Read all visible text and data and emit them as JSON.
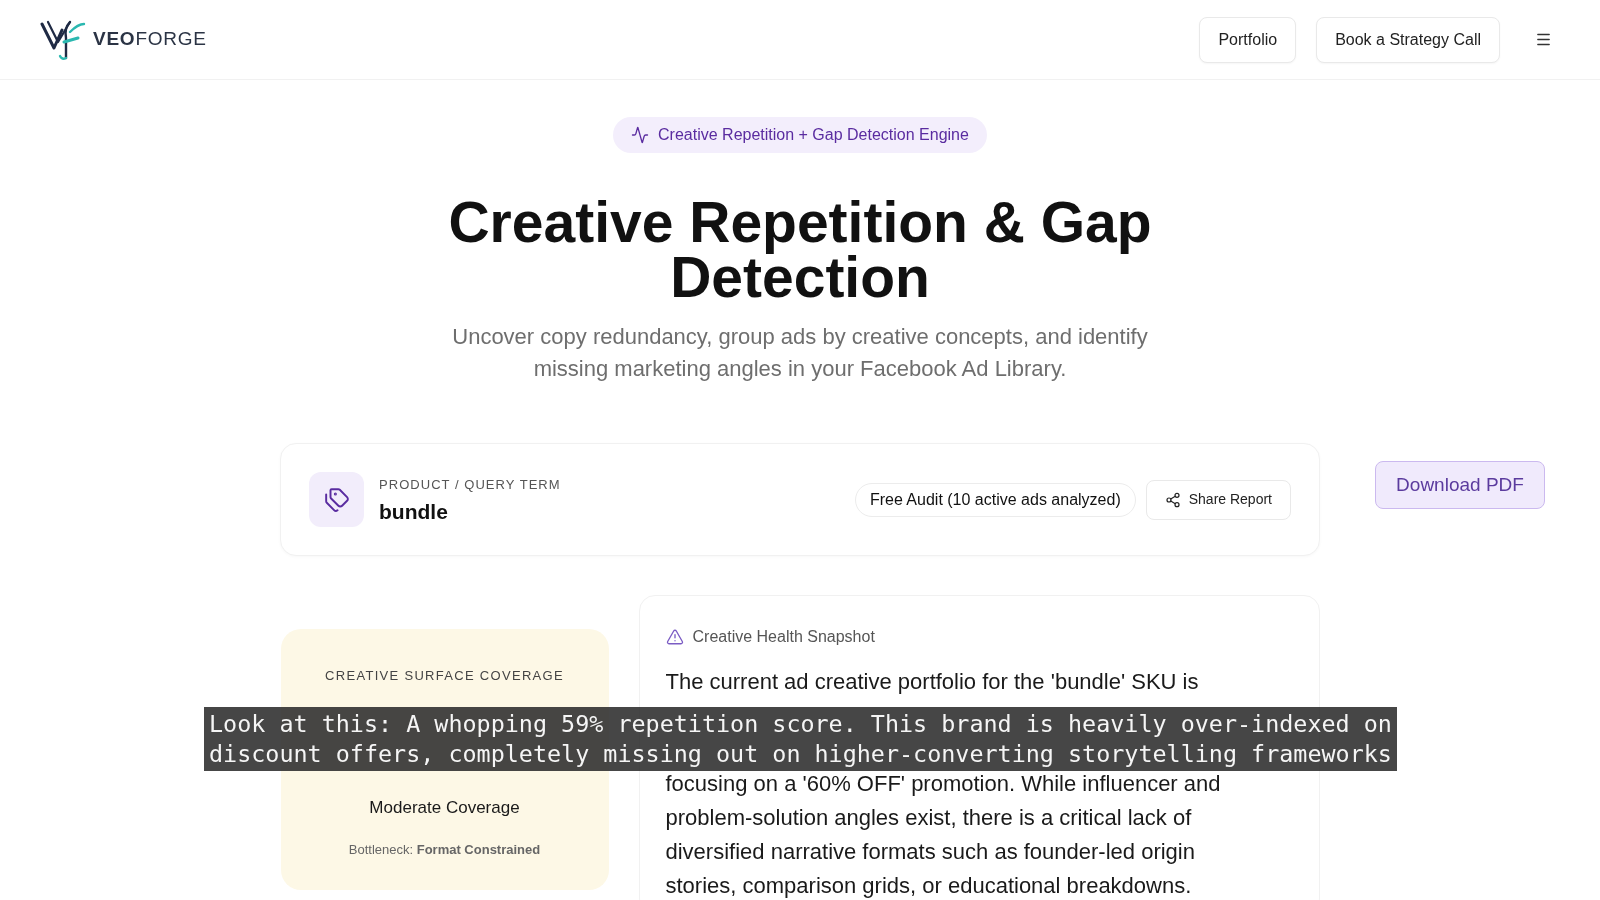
{
  "header": {
    "brand": "**VEO**FORGE",
    "nav_buttons": [
      "Portfolio",
      "Book a Strategy Call"
    ]
  },
  "hero": {
    "badge": "Creative Repetition + Gap Detection Engine",
    "title": "Creative Repetition & Gap Detection",
    "subtitle": "Uncover copy redundancy, group ads by creative concepts, and identify missing marketing angles in your Facebook Ad Library."
  },
  "query_card": {
    "label": "PRODUCT / QUERY TERM",
    "value": "bundle",
    "audit_pill": "Free Audit (10 active ads analyzed)",
    "share_button": "Share Report"
  },
  "download_button": "Download PDF",
  "coverage_card": {
    "heading": "CREATIVE SURFACE COVERAGE",
    "rating": "Moderate Coverage",
    "bottleneck": "Bottleneck: **Format Constrained**"
  },
  "snapshot": {
    "title": "Creative Health Snapshot",
    "text_fragments": [
      "The current ad creative portfolio for the 'bundle' SKU is",
      "focusing on a '60% OFF' promotion. While influencer and problem-solution angles exist, there is a critical lack of diversified narrative formats such as founder-led origin stories, comparison grids, or educational breakdowns."
    ]
  },
  "caption": "Look at this: A whopping 59% repetition score. This brand is heavily over-indexed on discount offers, completely missing out on higher-converting storytelling frameworks"
}
